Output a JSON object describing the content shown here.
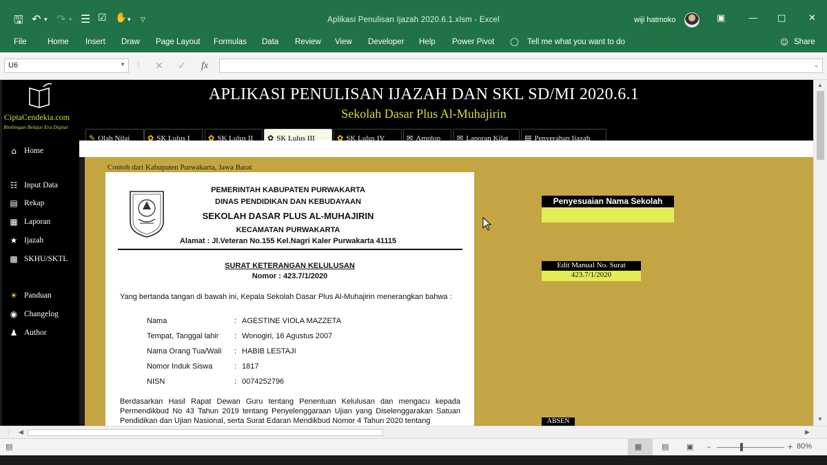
{
  "window": {
    "title": "Aplikasi Penulisan Ijazah 2020.6.1.xlsm  -  Excel",
    "user": "wiji hatmoko"
  },
  "qat_icons": [
    "save-icon",
    "undo-icon",
    "redo-icon",
    "form-icon",
    "check-icon",
    "macro-icon",
    "dropdown-icon"
  ],
  "ribbon": {
    "tabs": [
      "File",
      "Home",
      "Insert",
      "Draw",
      "Page Layout",
      "Formulas",
      "Data",
      "Review",
      "View",
      "Developer",
      "Help",
      "Power Pivot"
    ],
    "tell_me": "Tell me what you want to do",
    "share": "Share"
  },
  "formula_bar": {
    "name_box": "U6",
    "fx": "fx",
    "value": ""
  },
  "sidebar": {
    "brand": "CiptaCendekia.com",
    "brand_sub": "Bimbingan Belajar Era Digital",
    "items": [
      {
        "label": "Home",
        "icon": "home-icon"
      },
      {
        "label": "Input Data",
        "icon": "input-data-icon"
      },
      {
        "label": "Rekap",
        "icon": "rekap-icon"
      },
      {
        "label": "Laporan",
        "icon": "laporan-icon"
      },
      {
        "label": "Ijazah",
        "icon": "ijazah-icon"
      },
      {
        "label": "SKHU/SKTL",
        "icon": "skhu-icon"
      },
      {
        "label": "Panduan",
        "icon": "lightbulb-icon"
      },
      {
        "label": "Changelog",
        "icon": "eye-icon"
      },
      {
        "label": "Author",
        "icon": "person-icon"
      }
    ]
  },
  "header": {
    "title": "APLIKASI PENULISAN IJAZAH DAN SKL SD/MI 2020.6.1",
    "subtitle": "Sekolah Dasar Plus Al-Muhajirin"
  },
  "tabs": [
    {
      "label": "Olah Nilai"
    },
    {
      "label": "SK Lulus I"
    },
    {
      "label": "SK Lulus II"
    },
    {
      "label": "SK Lulus III",
      "active": true
    },
    {
      "label": "SK Lulus IV"
    },
    {
      "label": "Amplop"
    },
    {
      "label": "Laporan Kilat"
    },
    {
      "label": "Penyerahan Ijazah"
    }
  ],
  "content": {
    "caption": "Contoh dari Kabupaten Purwakarta, Jawa Barat",
    "letter": {
      "kop": [
        "PEMERINTAH KABUPATEN PURWAKARTA",
        "DINAS PENDIDIKAN DAN KEBUDAYAAN",
        "SEKOLAH DASAR PLUS AL-MUHAJIRIN",
        "KECAMATAN PURWAKARTA",
        "Alamat : Jl.Veteran No.155 Kel.Nagri Kaler Purwakarta  41115"
      ],
      "title": "SURAT KETERANGAN KELULUSAN",
      "number": "Nomor : 423.7/1/2020",
      "intro": "Yang bertanda tangan di bawah ini, Kepala Sekolah Dasar Plus Al-Muhajirin menerangkan bahwa :",
      "fields": [
        {
          "label": "Nama",
          "value": "AGESTINE VIOLA MAZZETA"
        },
        {
          "label": "Tempat, Tanggal lahir",
          "value": "Wonogiri, 16 Agustus 2007"
        },
        {
          "label": "Nama Orang Tua/Wali",
          "value": "HABIB LESTAJI"
        },
        {
          "label": "Nomor Induk Siswa",
          "value": "1817"
        },
        {
          "label": "NISN",
          "value": "0074252796"
        }
      ],
      "separator": ":",
      "paragraph": "Berdasarkan Hasil Rapat Dewan Guru tentang Penentuan Kelulusan dan mengacu kepada Permendikbud No 43 Tahun 2019 tentang Penyelenggaraan Ujian yang Diselenggarakan Satuan Pendidikan dan Ujian Nasional, serta Surat Edaran Mendikbud Nomor 4 Tahun 2020 tentang"
    },
    "panel": {
      "school_name_header": "Penyesuaian Nama Sekolah",
      "school_name_value": "",
      "edit_header": "Edit Manual No. Surat",
      "edit_value": "423.7/1/2020",
      "absen": "ABSEN"
    }
  },
  "status": {
    "zoom": "80%"
  },
  "colors": {
    "excel_green": "#217346",
    "content_gold": "#c3a643",
    "highlight_yellow": "#e2ec56",
    "subtitle_yellow": "#d9de39"
  }
}
